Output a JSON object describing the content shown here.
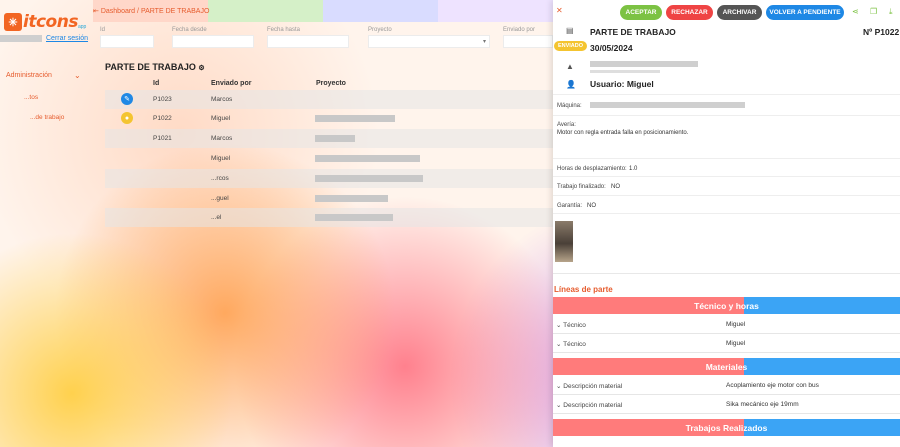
{
  "app": {
    "logo_text": "itcons",
    "logo_suffix": "app",
    "logout": "Cerrar sesión"
  },
  "sidebar": {
    "admin_label": "Administración",
    "items": [
      {
        "label": "...tos"
      },
      {
        "label": "...de trabajo"
      }
    ]
  },
  "breadcrumb": {
    "home": "Dashboard",
    "separator": "/",
    "current": "PARTE DE TRABAJO"
  },
  "filters": {
    "labels": [
      "Id",
      "Fecha desde",
      "Fecha hasta",
      "Proyecto",
      "Enviado por"
    ]
  },
  "list": {
    "title": "PARTE DE TRABAJO",
    "columns": [
      "Id",
      "Enviado por",
      "Proyecto"
    ],
    "rows": [
      {
        "id": "P1023",
        "sender": "Marcos"
      },
      {
        "id": "P1022",
        "sender": "Miguel"
      },
      {
        "id": "P1021",
        "sender": "Marcos"
      },
      {
        "id": "",
        "sender": "Miguel"
      },
      {
        "id": "",
        "sender": "...rcos"
      },
      {
        "id": "",
        "sender": "...guel"
      },
      {
        "id": "",
        "sender": "...el"
      }
    ]
  },
  "panel": {
    "actions": {
      "accept": "ACEPTAR",
      "reject": "RECHAZAR",
      "archive": "ARCHIVAR",
      "back_pending": "VOLVER A PENDIENTE"
    },
    "title": "PARTE DE TRABAJO",
    "number": "Nº P1022",
    "status": "ENVIADO",
    "date": "30/05/2024",
    "user": "Usuario: Miguel",
    "machine_label": "Máquina:",
    "fault_label": "Avería:",
    "fault_text": "Motor con regla entrada falla en posicionamiento.",
    "travel_label": "Horas de desplazamiento:",
    "travel_value": "1.0",
    "finished_label": "Trabajo finalizado:",
    "finished_value": "NO",
    "warranty_label": "Garantía:",
    "warranty_value": "NO",
    "lines_title": "Líneas de parte",
    "sections": {
      "tech": {
        "title": "Técnico y horas",
        "rows": [
          {
            "k": "Técnico",
            "v": "Miguel"
          },
          {
            "k": "Técnico",
            "v": "Miguel"
          }
        ]
      },
      "materials": {
        "title": "Materiales",
        "rows": [
          {
            "k": "Descripción material",
            "v": "Acoplamiento eje motor con bus"
          },
          {
            "k": "Descripción material",
            "v": "Sika mecánico eje 19mm"
          }
        ]
      },
      "works": {
        "title": "Trabajos Realizados"
      }
    }
  },
  "colors": {
    "accent": "#e65c2e",
    "accept": "#7cc243",
    "reject": "#ef4444",
    "archive": "#555555",
    "back": "#1e88e5",
    "status": "#f4c430"
  }
}
